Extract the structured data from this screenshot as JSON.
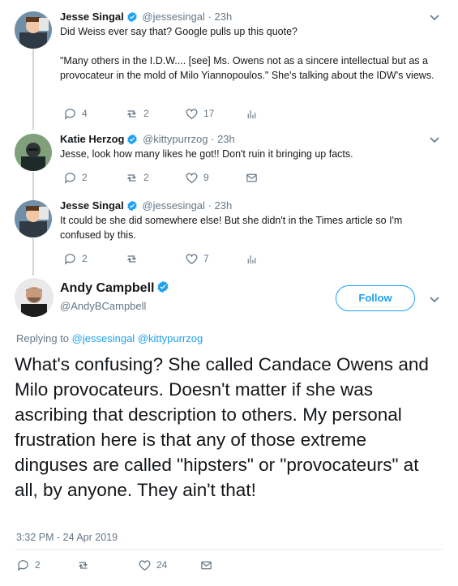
{
  "replies": [
    {
      "name": "Jesse Singal",
      "handle": "@jessesingal",
      "dot": "·",
      "time": "23h",
      "text": "Did Weiss ever say that? Google pulls up this quote?\n\n\"Many others in the I.D.W.... [see] Ms. Owens not as a sincere intellectual but as a provocateur in the mold of Milo Yiannopoulos.\" She's talking about the IDW's views.",
      "replies": "4",
      "retweets": "2",
      "likes": "17",
      "extra_icon": "analytics-icon"
    },
    {
      "name": "Katie Herzog",
      "handle": "@kittypurrzog",
      "dot": "·",
      "time": "23h",
      "text": "Jesse, look how many likes he got!! Don't ruin it bringing up facts.",
      "replies": "2",
      "retweets": "2",
      "likes": "9",
      "extra_icon": "envelope-icon"
    },
    {
      "name": "Jesse Singal",
      "handle": "@jessesingal",
      "dot": "·",
      "time": "23h",
      "text": "It could be she did somewhere else! But she didn't in the Times article so I'm confused by this.",
      "replies": "2",
      "retweets": "",
      "likes": "7",
      "extra_icon": "analytics-icon"
    }
  ],
  "main": {
    "name": "Andy Campbell",
    "handle": "@AndyBCampbell",
    "follow_label": "Follow",
    "replying_prefix": "Replying to",
    "replying_to": [
      "@jessesingal",
      "@kittypurrzog"
    ],
    "text": "What's confusing? She called Candace Owens and Milo provocateurs. Doesn't matter if she was ascribing that description to others. My personal frustration here is that any of those extreme dinguses are called \"hipsters\" or \"provocateurs\" at all, by anyone. They ain't that!",
    "timestamp": "3:32 PM - 24 Apr 2019",
    "replies": "2",
    "retweets": "",
    "likes": "24"
  },
  "colors": {
    "brand": "#1da1f2",
    "muted": "#657786",
    "thread_line": "#ccd6dd"
  }
}
